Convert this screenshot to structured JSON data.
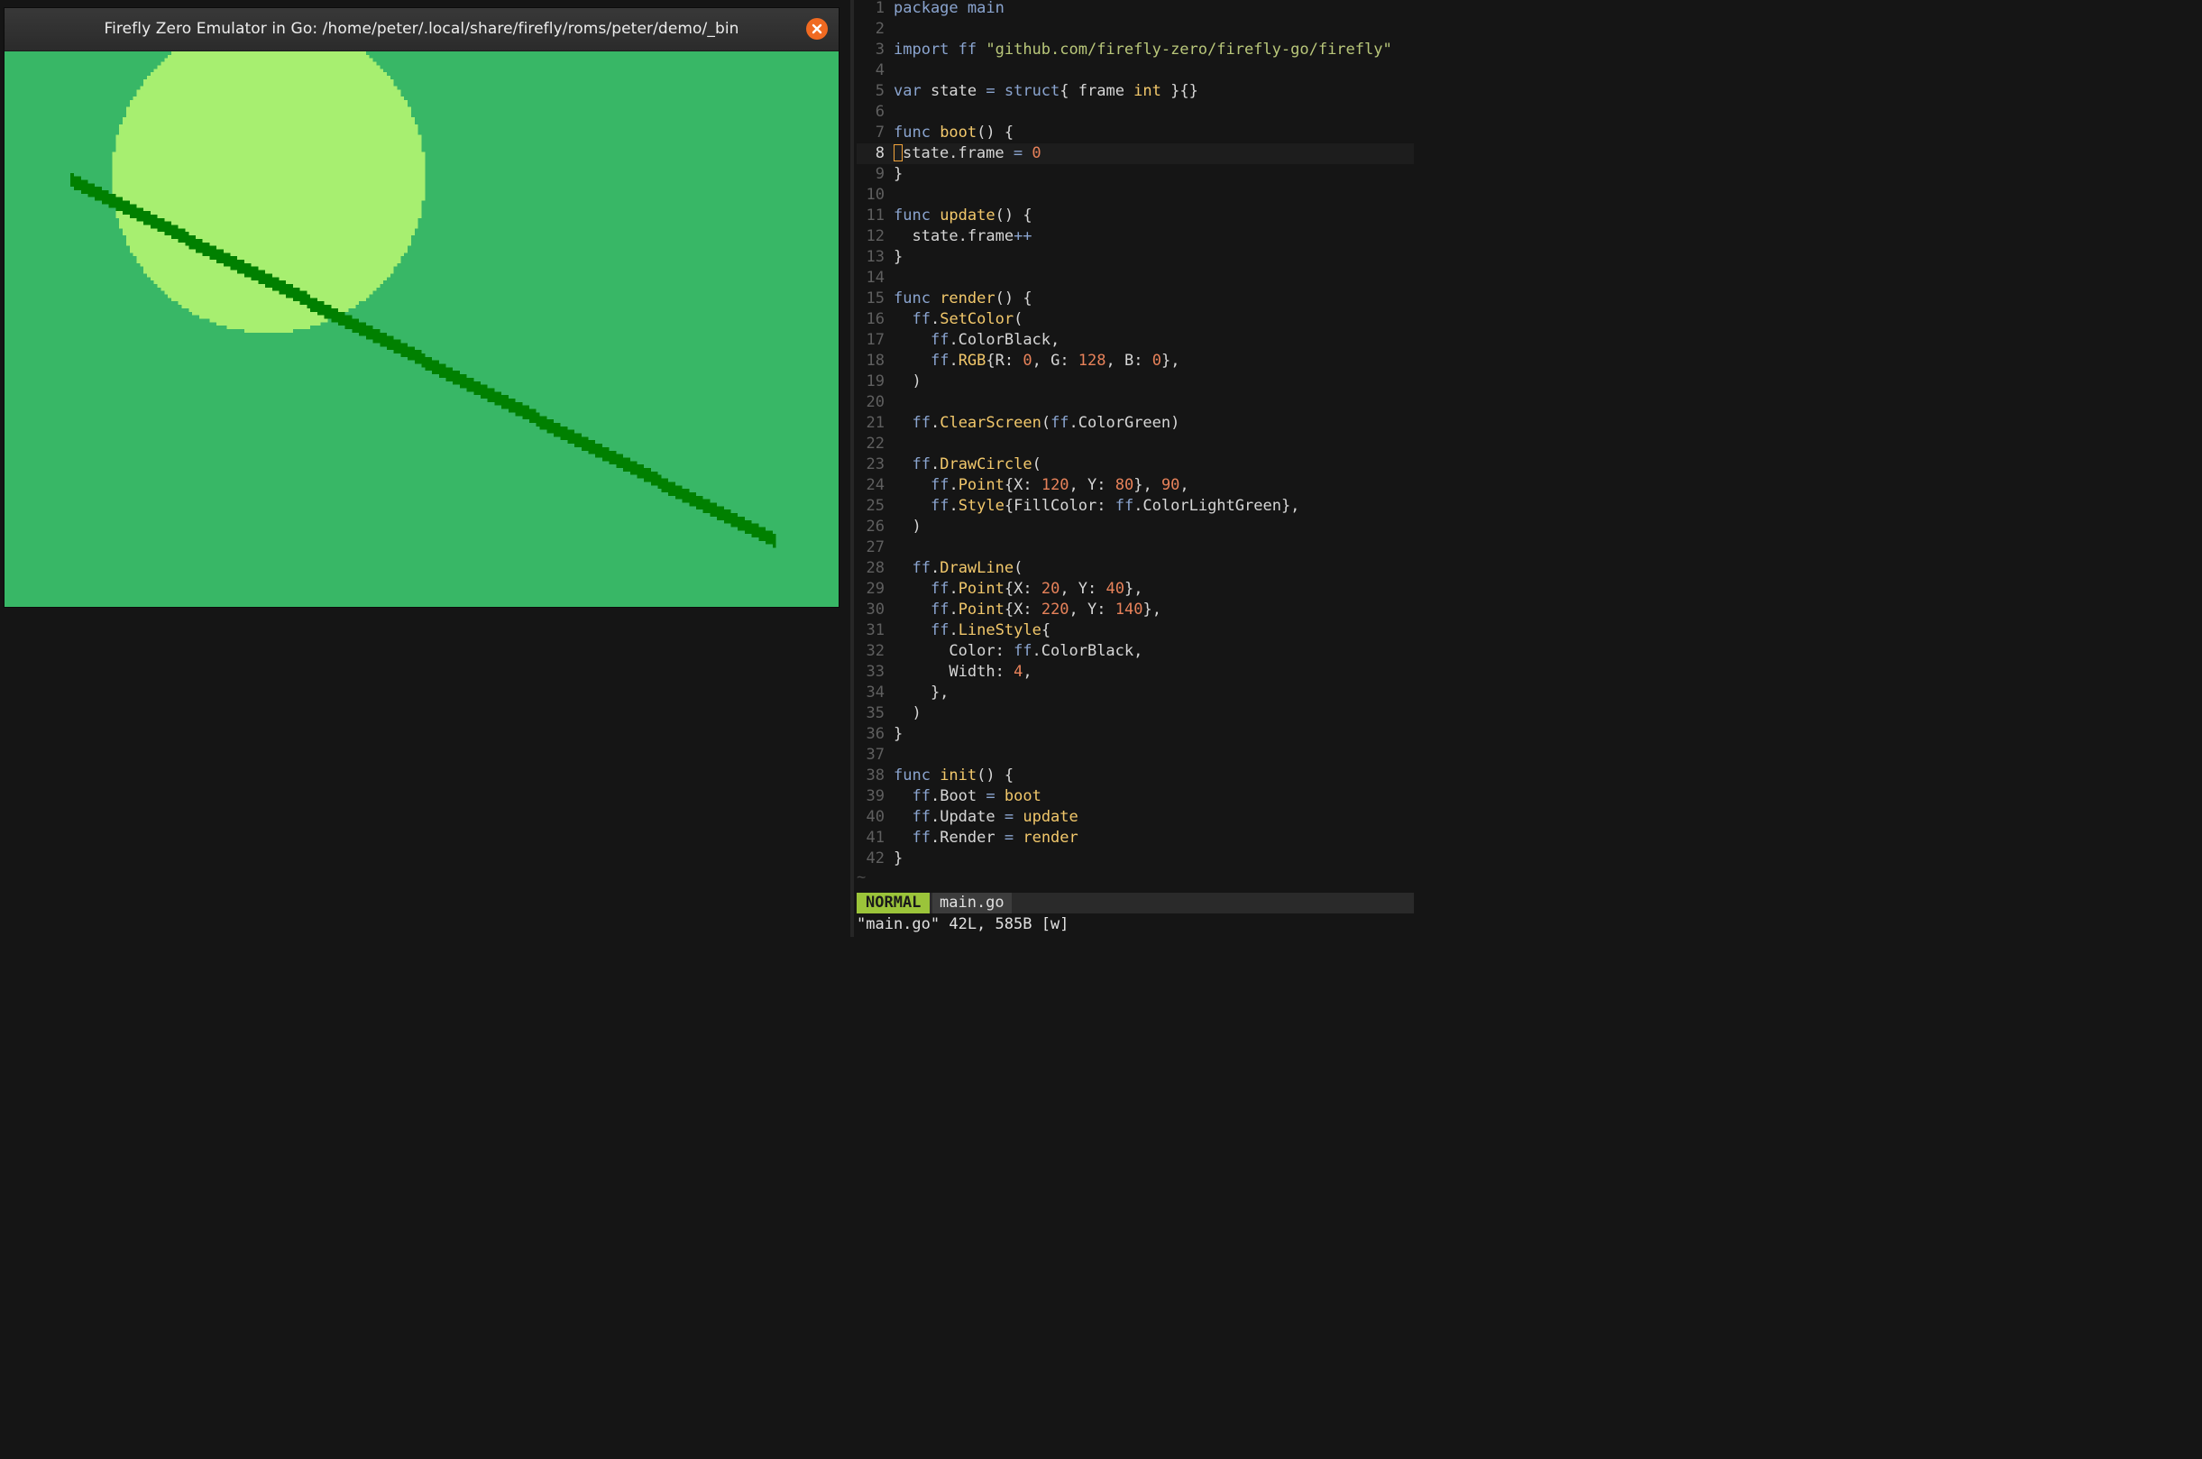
{
  "emulator": {
    "title": "Firefly Zero Emulator in Go: /home/peter/.local/share/firefly/roms/peter/demo/_bin",
    "close_icon": "close-icon",
    "screen": {
      "background": "#38b766",
      "circle_color": "#a7ef70",
      "line_color": "#008000"
    }
  },
  "editor": {
    "current_line": 8,
    "lines": [
      {
        "n": "1",
        "segments": [
          {
            "t": "package ",
            "c": "kw"
          },
          {
            "t": "main",
            "c": "kw"
          }
        ]
      },
      {
        "n": "2",
        "segments": []
      },
      {
        "n": "3",
        "segments": [
          {
            "t": "import ",
            "c": "kw"
          },
          {
            "t": "ff ",
            "c": "pkg"
          },
          {
            "t": "\"github.com/firefly-zero/firefly-go/firefly\"",
            "c": "str"
          }
        ]
      },
      {
        "n": "4",
        "segments": []
      },
      {
        "n": "5",
        "segments": [
          {
            "t": "var ",
            "c": "kw"
          },
          {
            "t": "state ",
            "c": ""
          },
          {
            "t": "= ",
            "c": "op"
          },
          {
            "t": "struct",
            "c": "kw"
          },
          {
            "t": "{ frame ",
            "c": ""
          },
          {
            "t": "int",
            "c": "typ"
          },
          {
            "t": " }{}",
            "c": ""
          }
        ]
      },
      {
        "n": "6",
        "segments": []
      },
      {
        "n": "7",
        "segments": [
          {
            "t": "func ",
            "c": "kw"
          },
          {
            "t": "boot",
            "c": "fn"
          },
          {
            "t": "() {",
            "c": ""
          }
        ]
      },
      {
        "n": "8",
        "cursor": true,
        "segments": [
          {
            "t": "state.frame ",
            "c": ""
          },
          {
            "t": "= ",
            "c": "op"
          },
          {
            "t": "0",
            "c": "num"
          }
        ]
      },
      {
        "n": "9",
        "segments": [
          {
            "t": "}",
            "c": ""
          }
        ]
      },
      {
        "n": "10",
        "segments": []
      },
      {
        "n": "11",
        "segments": [
          {
            "t": "func ",
            "c": "kw"
          },
          {
            "t": "update",
            "c": "fn"
          },
          {
            "t": "() {",
            "c": ""
          }
        ]
      },
      {
        "n": "12",
        "segments": [
          {
            "t": "  state.frame",
            "c": ""
          },
          {
            "t": "++",
            "c": "op"
          }
        ]
      },
      {
        "n": "13",
        "segments": [
          {
            "t": "}",
            "c": ""
          }
        ]
      },
      {
        "n": "14",
        "segments": []
      },
      {
        "n": "15",
        "segments": [
          {
            "t": "func ",
            "c": "kw"
          },
          {
            "t": "render",
            "c": "fn"
          },
          {
            "t": "() {",
            "c": ""
          }
        ]
      },
      {
        "n": "16",
        "segments": [
          {
            "t": "  ",
            "c": ""
          },
          {
            "t": "ff",
            "c": "pkg"
          },
          {
            "t": ".",
            "c": ""
          },
          {
            "t": "SetColor",
            "c": "fn"
          },
          {
            "t": "(",
            "c": ""
          }
        ]
      },
      {
        "n": "17",
        "segments": [
          {
            "t": "    ",
            "c": ""
          },
          {
            "t": "ff",
            "c": "pkg"
          },
          {
            "t": ".ColorBlack,",
            "c": ""
          }
        ]
      },
      {
        "n": "18",
        "segments": [
          {
            "t": "    ",
            "c": ""
          },
          {
            "t": "ff",
            "c": "pkg"
          },
          {
            "t": ".",
            "c": ""
          },
          {
            "t": "RGB",
            "c": "fn"
          },
          {
            "t": "{R: ",
            "c": ""
          },
          {
            "t": "0",
            "c": "num"
          },
          {
            "t": ", G: ",
            "c": ""
          },
          {
            "t": "128",
            "c": "num"
          },
          {
            "t": ", B: ",
            "c": ""
          },
          {
            "t": "0",
            "c": "num"
          },
          {
            "t": "},",
            "c": ""
          }
        ]
      },
      {
        "n": "19",
        "segments": [
          {
            "t": "  )",
            "c": ""
          }
        ]
      },
      {
        "n": "20",
        "segments": []
      },
      {
        "n": "21",
        "segments": [
          {
            "t": "  ",
            "c": ""
          },
          {
            "t": "ff",
            "c": "pkg"
          },
          {
            "t": ".",
            "c": ""
          },
          {
            "t": "ClearScreen",
            "c": "fn"
          },
          {
            "t": "(",
            "c": ""
          },
          {
            "t": "ff",
            "c": "pkg"
          },
          {
            "t": ".ColorGreen)",
            "c": ""
          }
        ]
      },
      {
        "n": "22",
        "segments": []
      },
      {
        "n": "23",
        "segments": [
          {
            "t": "  ",
            "c": ""
          },
          {
            "t": "ff",
            "c": "pkg"
          },
          {
            "t": ".",
            "c": ""
          },
          {
            "t": "DrawCircle",
            "c": "fn"
          },
          {
            "t": "(",
            "c": ""
          }
        ]
      },
      {
        "n": "24",
        "segments": [
          {
            "t": "    ",
            "c": ""
          },
          {
            "t": "ff",
            "c": "pkg"
          },
          {
            "t": ".",
            "c": ""
          },
          {
            "t": "Point",
            "c": "fn"
          },
          {
            "t": "{X: ",
            "c": ""
          },
          {
            "t": "120",
            "c": "num"
          },
          {
            "t": ", Y: ",
            "c": ""
          },
          {
            "t": "80",
            "c": "num"
          },
          {
            "t": "}, ",
            "c": ""
          },
          {
            "t": "90",
            "c": "num"
          },
          {
            "t": ",",
            "c": ""
          }
        ]
      },
      {
        "n": "25",
        "segments": [
          {
            "t": "    ",
            "c": ""
          },
          {
            "t": "ff",
            "c": "pkg"
          },
          {
            "t": ".",
            "c": ""
          },
          {
            "t": "Style",
            "c": "fn"
          },
          {
            "t": "{FillColor: ",
            "c": ""
          },
          {
            "t": "ff",
            "c": "pkg"
          },
          {
            "t": ".ColorLightGreen},",
            "c": ""
          }
        ]
      },
      {
        "n": "26",
        "segments": [
          {
            "t": "  )",
            "c": ""
          }
        ]
      },
      {
        "n": "27",
        "segments": []
      },
      {
        "n": "28",
        "segments": [
          {
            "t": "  ",
            "c": ""
          },
          {
            "t": "ff",
            "c": "pkg"
          },
          {
            "t": ".",
            "c": ""
          },
          {
            "t": "DrawLine",
            "c": "fn"
          },
          {
            "t": "(",
            "c": ""
          }
        ]
      },
      {
        "n": "29",
        "segments": [
          {
            "t": "    ",
            "c": ""
          },
          {
            "t": "ff",
            "c": "pkg"
          },
          {
            "t": ".",
            "c": ""
          },
          {
            "t": "Point",
            "c": "fn"
          },
          {
            "t": "{X: ",
            "c": ""
          },
          {
            "t": "20",
            "c": "num"
          },
          {
            "t": ", Y: ",
            "c": ""
          },
          {
            "t": "40",
            "c": "num"
          },
          {
            "t": "},",
            "c": ""
          }
        ]
      },
      {
        "n": "30",
        "segments": [
          {
            "t": "    ",
            "c": ""
          },
          {
            "t": "ff",
            "c": "pkg"
          },
          {
            "t": ".",
            "c": ""
          },
          {
            "t": "Point",
            "c": "fn"
          },
          {
            "t": "{X: ",
            "c": ""
          },
          {
            "t": "220",
            "c": "num"
          },
          {
            "t": ", Y: ",
            "c": ""
          },
          {
            "t": "140",
            "c": "num"
          },
          {
            "t": "},",
            "c": ""
          }
        ]
      },
      {
        "n": "31",
        "segments": [
          {
            "t": "    ",
            "c": ""
          },
          {
            "t": "ff",
            "c": "pkg"
          },
          {
            "t": ".",
            "c": ""
          },
          {
            "t": "LineStyle",
            "c": "fn"
          },
          {
            "t": "{",
            "c": ""
          }
        ]
      },
      {
        "n": "32",
        "segments": [
          {
            "t": "      Color: ",
            "c": ""
          },
          {
            "t": "ff",
            "c": "pkg"
          },
          {
            "t": ".ColorBlack,",
            "c": ""
          }
        ]
      },
      {
        "n": "33",
        "segments": [
          {
            "t": "      Width: ",
            "c": ""
          },
          {
            "t": "4",
            "c": "num"
          },
          {
            "t": ",",
            "c": ""
          }
        ]
      },
      {
        "n": "34",
        "segments": [
          {
            "t": "    },",
            "c": ""
          }
        ]
      },
      {
        "n": "35",
        "segments": [
          {
            "t": "  )",
            "c": ""
          }
        ]
      },
      {
        "n": "36",
        "segments": [
          {
            "t": "}",
            "c": ""
          }
        ]
      },
      {
        "n": "37",
        "segments": []
      },
      {
        "n": "38",
        "segments": [
          {
            "t": "func ",
            "c": "kw"
          },
          {
            "t": "init",
            "c": "fn"
          },
          {
            "t": "() {",
            "c": ""
          }
        ]
      },
      {
        "n": "39",
        "segments": [
          {
            "t": "  ",
            "c": ""
          },
          {
            "t": "ff",
            "c": "pkg"
          },
          {
            "t": ".Boot ",
            "c": ""
          },
          {
            "t": "= ",
            "c": "op"
          },
          {
            "t": "boot",
            "c": "fn"
          }
        ]
      },
      {
        "n": "40",
        "segments": [
          {
            "t": "  ",
            "c": ""
          },
          {
            "t": "ff",
            "c": "pkg"
          },
          {
            "t": ".Update ",
            "c": ""
          },
          {
            "t": "= ",
            "c": "op"
          },
          {
            "t": "update",
            "c": "fn"
          }
        ]
      },
      {
        "n": "41",
        "segments": [
          {
            "t": "  ",
            "c": ""
          },
          {
            "t": "ff",
            "c": "pkg"
          },
          {
            "t": ".Render ",
            "c": ""
          },
          {
            "t": "= ",
            "c": "op"
          },
          {
            "t": "render",
            "c": "fn"
          }
        ]
      },
      {
        "n": "42",
        "segments": [
          {
            "t": "}",
            "c": ""
          }
        ]
      }
    ],
    "empty_marker": "~"
  },
  "statusline": {
    "mode": "NORMAL",
    "filename": "main.go",
    "mode_color": "#9bc43a"
  },
  "cmdline": {
    "message": "\"main.go\" 42L, 585B [w]"
  }
}
